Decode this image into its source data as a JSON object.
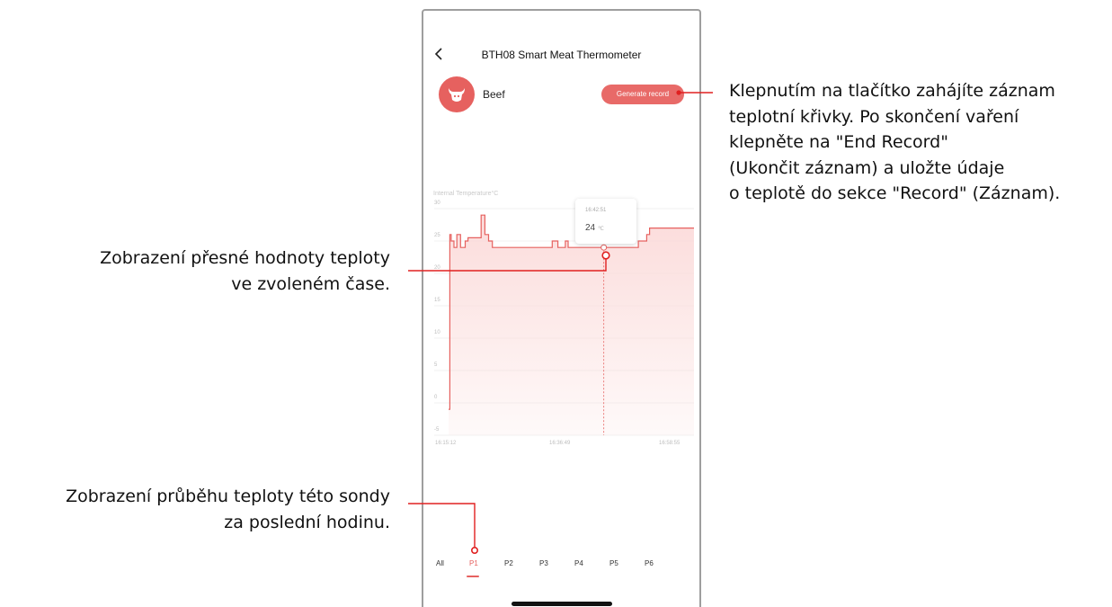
{
  "app": {
    "title": "BTH08 Smart Meat Thermometer",
    "back_icon": "chevron-left-icon",
    "food_icon": "beef-icon",
    "food_label": "Beef",
    "generate_button": "Generate record"
  },
  "chart": {
    "title": "Internal Temperature°C",
    "y_ticks": [
      "30",
      "25",
      "20",
      "15",
      "10",
      "5",
      "0",
      "-5"
    ],
    "x_ticks": [
      "16:15:12",
      "16:36:49",
      "16:58:55"
    ],
    "tooltip": {
      "time": "16:42:51",
      "value": "24",
      "unit": "℃"
    }
  },
  "chart_data": {
    "type": "area",
    "title": "Internal Temperature°C",
    "ylim": [
      -5,
      30
    ],
    "x_ticks": [
      "16:15:12",
      "16:36:49",
      "16:58:55"
    ],
    "series": [
      {
        "x": [
          "16:15:12",
          "16:15:25",
          "16:15:40",
          "16:16:10",
          "16:16:40",
          "16:17:20",
          "16:18:10",
          "16:18:40",
          "16:20:40",
          "16:21:00",
          "16:21:40",
          "16:22:20",
          "16:23:00",
          "16:24:40",
          "16:27:00",
          "16:33:00",
          "16:33:40",
          "16:34:40",
          "16:36:00",
          "16:36:30",
          "16:48:00",
          "16:49:00",
          "16:50:30",
          "16:51:00",
          "16:58:55"
        ],
        "values": [
          -1,
          26,
          25,
          24,
          26,
          24,
          25,
          25.5,
          25.5,
          29,
          26,
          25,
          24,
          24,
          24,
          24,
          25,
          24,
          25,
          24,
          24,
          25,
          26,
          27,
          27
        ]
      }
    ],
    "selected": {
      "x": "16:42:51",
      "y": 24
    },
    "grid": true,
    "colors": {
      "line": "#e6615f",
      "fill": "#fbdad9"
    }
  },
  "tabs": [
    "All",
    "P1",
    "P2",
    "P3",
    "P4",
    "P5",
    "P6"
  ],
  "active_tab": "P1",
  "annotations": {
    "right": [
      "Klepnutím na tlačítko zahájíte záznam",
      "teplotní křivky. Po skončení vaření",
      "klepněte na \"End Record\"",
      "(Ukončit záznam) a uložte údaje",
      "o teplotě do sekce \"Record\" (Záznam)."
    ],
    "left1": [
      "Zobrazení přesné hodnoty teploty",
      "ve zvoleném čase."
    ],
    "left2": [
      "Zobrazení průběhu teploty této sondy",
      "za poslední hodinu."
    ]
  },
  "colors": {
    "accent": "#e6615f",
    "callout": "#e02020"
  }
}
